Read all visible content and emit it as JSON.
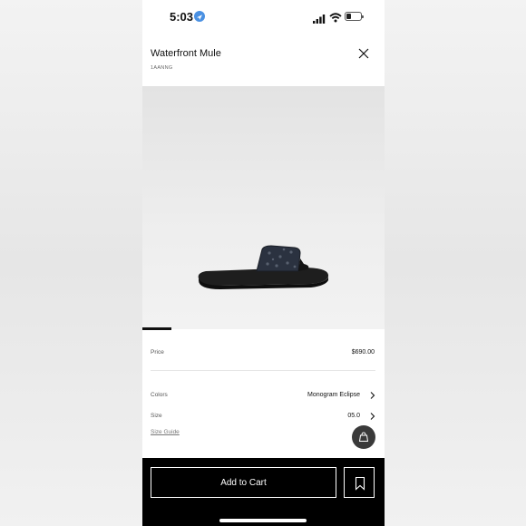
{
  "status_bar": {
    "time": "5:03",
    "battery_level": 0.3
  },
  "product": {
    "title": "Waterfront Mule",
    "sku": "1AANNG",
    "image_description": "black slide sandal with navy monogram eclipse strap"
  },
  "carousel": {
    "active_index": 1
  },
  "details": {
    "price_label": "Price",
    "price_value": "$690.00",
    "colors_label": "Colors",
    "colors_value": "Monogram Eclipse",
    "size_label": "Size",
    "size_value": "05.0",
    "size_guide_label": "Size Guide"
  },
  "actions": {
    "add_to_cart_label": "Add to Cart"
  },
  "icons": {
    "close": "close-icon",
    "chevron": "chevron-right-icon",
    "bag": "shopping-bag-icon",
    "bookmark": "bookmark-icon",
    "location": "location-arrow-icon",
    "signal": "cellular-signal-icon",
    "wifi": "wifi-icon",
    "battery": "battery-icon"
  },
  "colors": {
    "bottom_bar": "#000000",
    "fab": "#3a3a3a",
    "location": "#4a90e2"
  }
}
